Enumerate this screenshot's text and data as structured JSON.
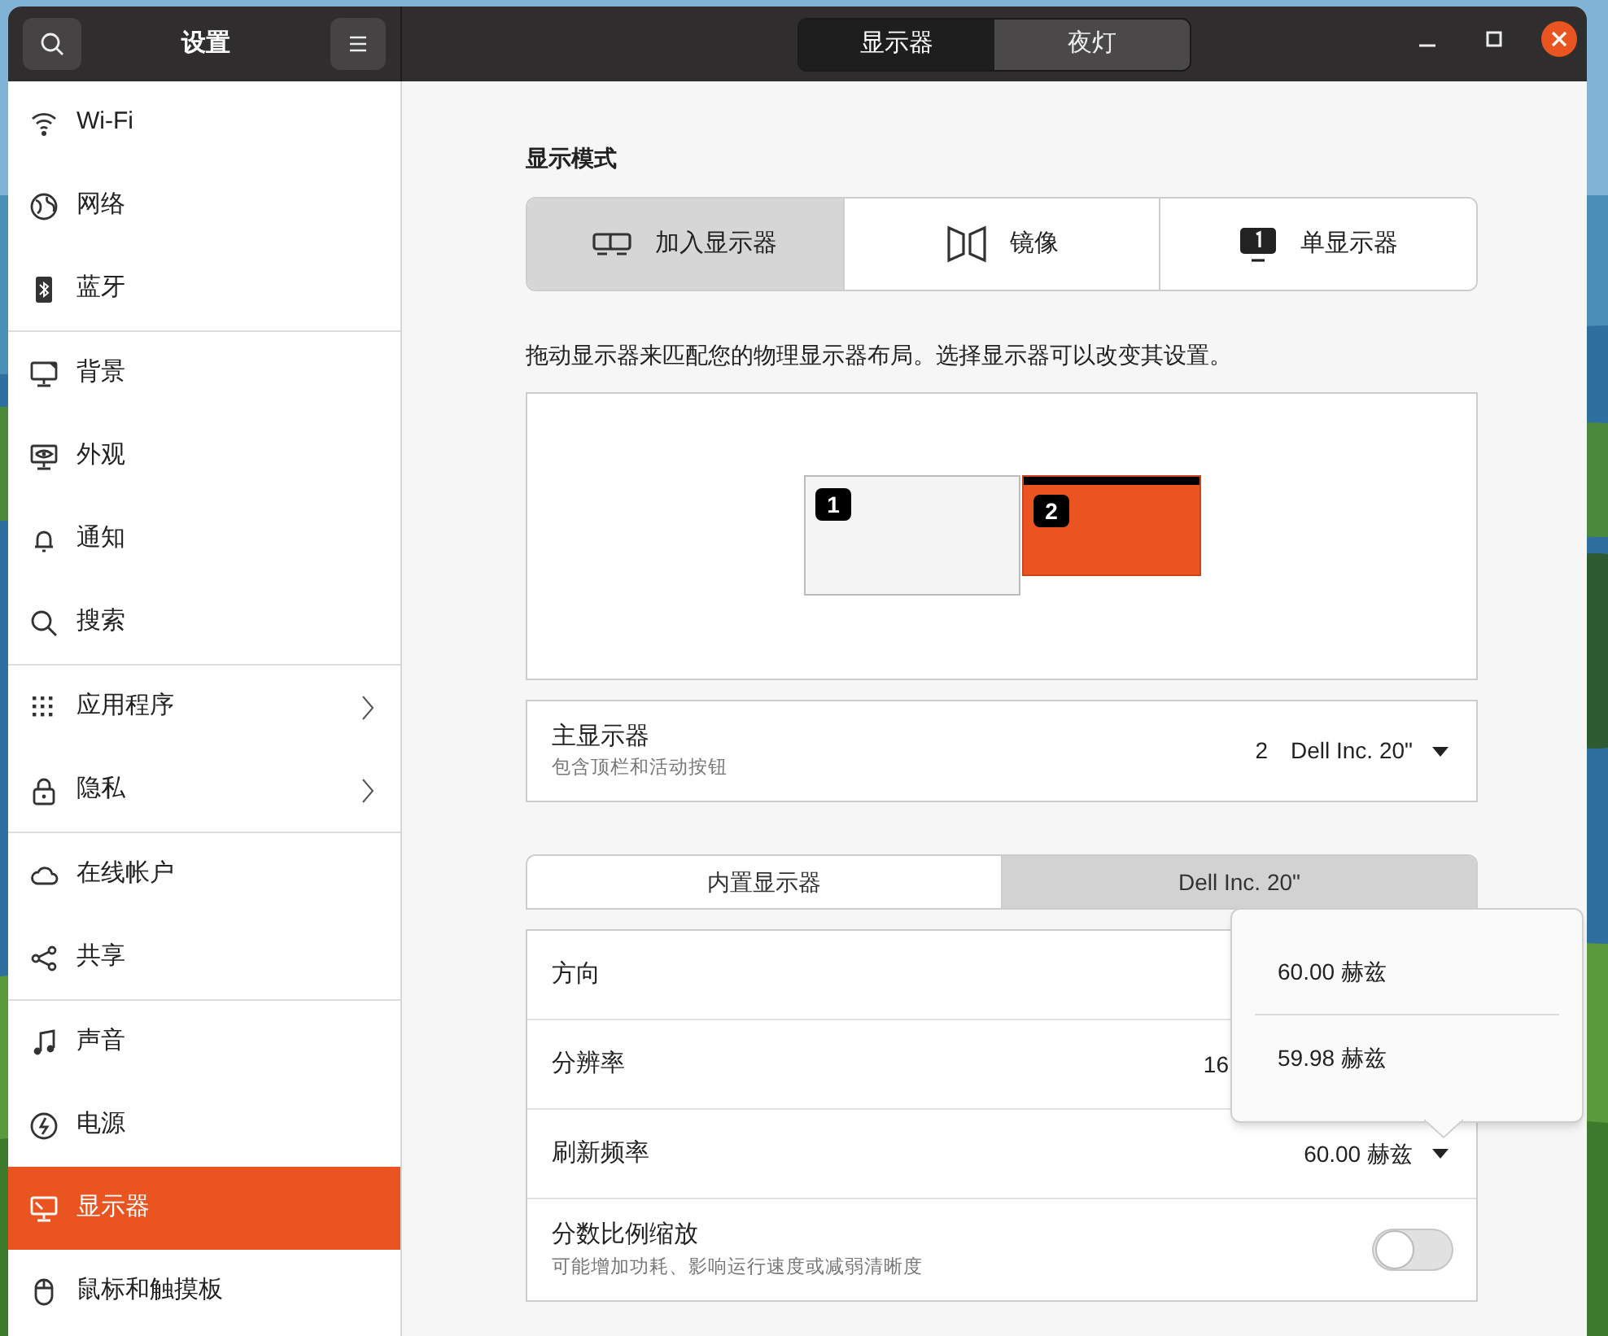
{
  "header": {
    "title": "设置",
    "view_switcher": [
      {
        "label": "显示器",
        "selected": true
      },
      {
        "label": "夜灯",
        "selected": false
      }
    ]
  },
  "sidebar": {
    "groups": [
      [
        {
          "kind": "wifi",
          "label": "Wi-Fi",
          "selected": false,
          "submenu": false
        },
        {
          "kind": "globe",
          "label": "网络",
          "selected": false,
          "submenu": false
        },
        {
          "kind": "bluetooth",
          "label": "蓝牙",
          "selected": false,
          "submenu": false
        }
      ],
      [
        {
          "kind": "monitor",
          "label": "背景",
          "selected": false,
          "submenu": false
        },
        {
          "kind": "monitor-eye",
          "label": "外观",
          "selected": false,
          "submenu": false
        },
        {
          "kind": "bell",
          "label": "通知",
          "selected": false,
          "submenu": false
        },
        {
          "kind": "search",
          "label": "搜索",
          "selected": false,
          "submenu": false
        }
      ],
      [
        {
          "kind": "grid",
          "label": "应用程序",
          "selected": false,
          "submenu": true
        },
        {
          "kind": "lock",
          "label": "隐私",
          "selected": false,
          "submenu": true
        }
      ],
      [
        {
          "kind": "cloud",
          "label": "在线帐户",
          "selected": false,
          "submenu": false
        },
        {
          "kind": "share",
          "label": "共享",
          "selected": false,
          "submenu": false
        }
      ],
      [
        {
          "kind": "note",
          "label": "声音",
          "selected": false,
          "submenu": false
        },
        {
          "kind": "power",
          "label": "电源",
          "selected": false,
          "submenu": false
        },
        {
          "kind": "display",
          "label": "显示器",
          "selected": true,
          "submenu": false
        },
        {
          "kind": "mouse",
          "label": "鼠标和触摸板",
          "selected": false,
          "submenu": false
        }
      ]
    ]
  },
  "display_mode": {
    "title": "显示模式",
    "options": [
      {
        "kind": "join",
        "label": "加入显示器",
        "selected": true
      },
      {
        "kind": "mirror",
        "label": "镜像",
        "selected": false
      },
      {
        "kind": "single",
        "label": "单显示器",
        "selected": false
      }
    ]
  },
  "arrangement": {
    "hint": "拖动显示器来匹配您的物理显示器布局。选择显示器可以改变其设置。",
    "monitors": [
      {
        "number": "1",
        "selected": false,
        "primary": false
      },
      {
        "number": "2",
        "selected": true,
        "primary": true
      }
    ]
  },
  "primary_display": {
    "label": "主显示器",
    "sublabel": "包含顶栏和活动按钮",
    "number": "2",
    "value": "Dell Inc. 20\""
  },
  "monitor_tabs": [
    {
      "label": "内置显示器",
      "selected": false
    },
    {
      "label": "Dell Inc. 20\"",
      "selected": true
    }
  ],
  "settings": [
    {
      "kind": "label",
      "label": "方向"
    },
    {
      "kind": "label",
      "label": "分辨率",
      "value": "16"
    },
    {
      "kind": "combo",
      "label": "刷新频率",
      "value": "60.00 赫兹"
    },
    {
      "kind": "toggle",
      "label": "分数比例缩放",
      "sublabel": "可能增加功耗、影响运行速度或减弱清晰度",
      "on": false
    }
  ],
  "popover": {
    "options": [
      "60.00 赫兹",
      "59.98 赫兹"
    ]
  }
}
